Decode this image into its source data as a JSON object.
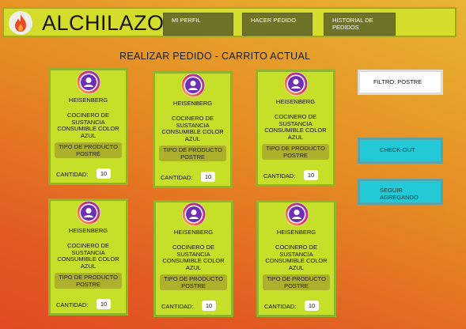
{
  "header": {
    "logo_icon": "flame-icon",
    "title": "ALCHILAZO",
    "nav": [
      "MI PERFIL",
      "HACER PEDIDO",
      "HISTORIAL DE PEDIDOS"
    ]
  },
  "main": {
    "title": "REALIZAR PEDIDO - CARRITO ACTUAL",
    "cards": [
      {
        "name": "HEISENBERG",
        "description": "COCINERO DE SUSTANCIA CONSUMIBLE COLOR AZUL",
        "type": "TIPO DE PRODUCTO POSTRE",
        "qty_label": "CANTIDAD:",
        "qty": "10"
      },
      {
        "name": "HEISENBERG",
        "description": "COCINERO DE SUSTANCIA CONSUMIBLE COLOR AZUL",
        "type": "TIPO DE PRODUCTO POSTRE",
        "qty_label": "CANTIDAD:",
        "qty": "10"
      },
      {
        "name": "HEISENBERG",
        "description": "COCINERO DE SUSTANCIA CONSUMIBLE COLOR AZUL",
        "type": "TIPO DE PRODUCTO POSTRE",
        "qty_label": "CANTIDAD:",
        "qty": "10"
      },
      {
        "name": "HEISENBERG",
        "description": "COCINERO DE SUSTANCIA CONSUMIBLE COLOR AZUL",
        "type": "TIPO DE PRODUCTO POSTRE",
        "qty_label": "CANTIDAD:",
        "qty": "10"
      },
      {
        "name": "HEISENBERG",
        "description": "COCINERO DE SUSTANCIA CONSUMIBLE COLOR AZUL",
        "type": "TIPO DE PRODUCTO POSTRE",
        "qty_label": "CANTIDAD:",
        "qty": "10"
      },
      {
        "name": "HEISENBERG",
        "description": "COCINERO DE SUSTANCIA CONSUMIBLE COLOR AZUL",
        "type": "TIPO DE PRODUCTO POSTRE",
        "qty_label": "CANTIDAD:",
        "qty": "10"
      }
    ]
  },
  "sidebar": {
    "filter": "FILTRO: POSTRE",
    "checkout": "CHECK-OUT",
    "continue": "SEGUIR AGREGANDO"
  },
  "colors": {
    "header_bg": "#d4dc2c",
    "nav_bg": "#6e7327",
    "card_bg": "#c6e02a",
    "button_bg": "#23c9d6"
  }
}
